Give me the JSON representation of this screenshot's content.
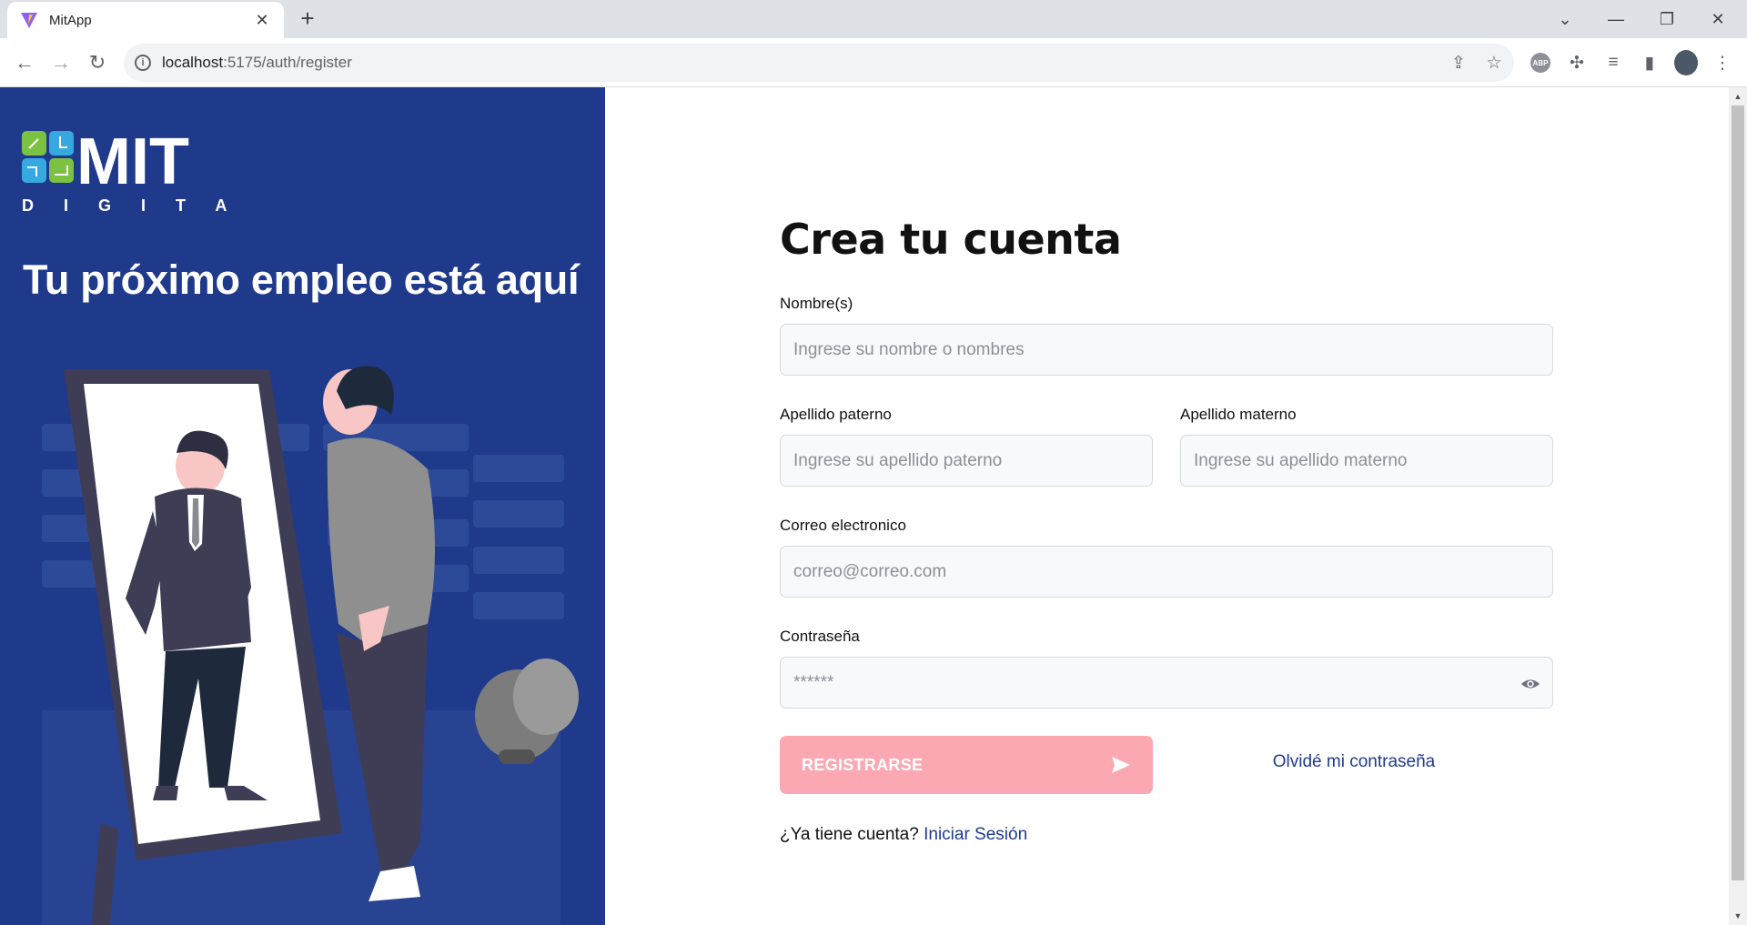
{
  "browser": {
    "tab_title": "MitApp",
    "url_host": "localhost",
    "url_path": ":5175/auth/register",
    "icons": [
      "back-icon",
      "forward-icon",
      "reload-icon",
      "info-icon",
      "share-icon",
      "star-icon",
      "abp-icon",
      "puzzle-icon",
      "queue-icon",
      "sidepanel-icon",
      "menu-icon"
    ],
    "abp_text": "ABP"
  },
  "left_panel": {
    "logo_text": "MIT",
    "logo_subtext": "D I G I T A L",
    "headline": "Tu próximo empleo está aquí",
    "bg_color": "#1f3a8b"
  },
  "form": {
    "title": "Crea tu cuenta",
    "nombre": {
      "label": "Nombre(s)",
      "placeholder": "Ingrese su nombre o nombres"
    },
    "apellido_paterno": {
      "label": "Apellido paterno",
      "placeholder": "Ingrese su apellido paterno"
    },
    "apellido_materno": {
      "label": "Apellido materno",
      "placeholder": "Ingrese su apellido materno"
    },
    "correo": {
      "label": "Correo electronico",
      "placeholder": "correo@correo.com"
    },
    "password": {
      "label": "Contraseña",
      "placeholder": "******"
    },
    "submit_label": "REGISTRARSE",
    "forgot_label": "Olvidé mi contraseña",
    "have_account": "¿Ya tiene cuenta?",
    "login_link": "Iniciar Sesión",
    "accent_color": "#fba8b3",
    "link_color": "#1f3a8b"
  }
}
